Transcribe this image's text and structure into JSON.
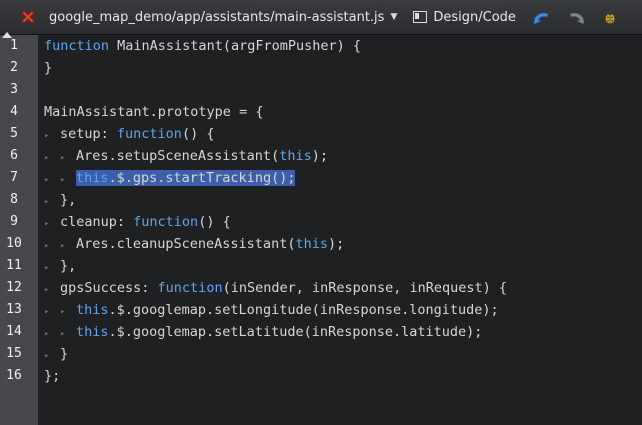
{
  "toolbar": {
    "file_path": "google_map_demo/app/assistants/main-assistant.js",
    "design_code_label": "Design/Code",
    "icons": [
      "close-icon",
      "chevron-down-icon",
      "design-code-icon",
      "back-arrow-icon",
      "forward-arrow-icon",
      "bug-icon"
    ]
  },
  "colors": {
    "keyword": "#5aa6f0",
    "text": "#d6d6d6",
    "selection": "#3d5ea8",
    "gutter": "#45474c",
    "background": "#1f2022"
  },
  "editor": {
    "line_numbers": [
      "1",
      "2",
      "3",
      "4",
      "5",
      "6",
      "7",
      "8",
      "9",
      "10",
      "11",
      "12",
      "13",
      "14",
      "15",
      "16"
    ],
    "lines": [
      {
        "indent": 0,
        "selected": false,
        "tokens": [
          {
            "t": "function",
            "k": true
          },
          {
            "t": " MainAssistant(argFromPusher) {",
            "k": false
          }
        ]
      },
      {
        "indent": 0,
        "selected": false,
        "tokens": [
          {
            "t": "}",
            "k": false
          }
        ]
      },
      {
        "indent": 0,
        "selected": false,
        "tokens": []
      },
      {
        "indent": 0,
        "selected": false,
        "tokens": [
          {
            "t": "MainAssistant.prototype = {",
            "k": false
          }
        ]
      },
      {
        "indent": 1,
        "selected": false,
        "tokens": [
          {
            "t": "setup: ",
            "k": false
          },
          {
            "t": "function",
            "k": true
          },
          {
            "t": "() {",
            "k": false
          }
        ]
      },
      {
        "indent": 2,
        "selected": false,
        "tokens": [
          {
            "t": "Ares.setupSceneAssistant(",
            "k": false
          },
          {
            "t": "this",
            "k": true
          },
          {
            "t": ");",
            "k": false
          }
        ]
      },
      {
        "indent": 2,
        "selected": true,
        "tokens": [
          {
            "t": "this",
            "k": true
          },
          {
            "t": ".$.gps.startTracking();",
            "k": false
          }
        ]
      },
      {
        "indent": 1,
        "selected": false,
        "tokens": [
          {
            "t": "},",
            "k": false
          }
        ]
      },
      {
        "indent": 1,
        "selected": false,
        "tokens": [
          {
            "t": "cleanup: ",
            "k": false
          },
          {
            "t": "function",
            "k": true
          },
          {
            "t": "() {",
            "k": false
          }
        ]
      },
      {
        "indent": 2,
        "selected": false,
        "tokens": [
          {
            "t": "Ares.cleanupSceneAssistant(",
            "k": false
          },
          {
            "t": "this",
            "k": true
          },
          {
            "t": ");",
            "k": false
          }
        ]
      },
      {
        "indent": 1,
        "selected": false,
        "tokens": [
          {
            "t": "},",
            "k": false
          }
        ]
      },
      {
        "indent": 1,
        "selected": false,
        "tokens": [
          {
            "t": "gpsSuccess: ",
            "k": false
          },
          {
            "t": "function",
            "k": true
          },
          {
            "t": "(inSender, inResponse, inRequest) {",
            "k": false
          }
        ]
      },
      {
        "indent": 2,
        "selected": false,
        "tokens": [
          {
            "t": "this",
            "k": true
          },
          {
            "t": ".$.googlemap.setLongitude(inResponse.longitude);",
            "k": false
          }
        ]
      },
      {
        "indent": 2,
        "selected": false,
        "tokens": [
          {
            "t": "this",
            "k": true
          },
          {
            "t": ".$.googlemap.setLatitude(inResponse.latitude);",
            "k": false
          }
        ]
      },
      {
        "indent": 1,
        "selected": false,
        "tokens": [
          {
            "t": "}",
            "k": false
          }
        ]
      },
      {
        "indent": 0,
        "selected": false,
        "tokens": [
          {
            "t": "};",
            "k": false
          }
        ]
      }
    ]
  }
}
